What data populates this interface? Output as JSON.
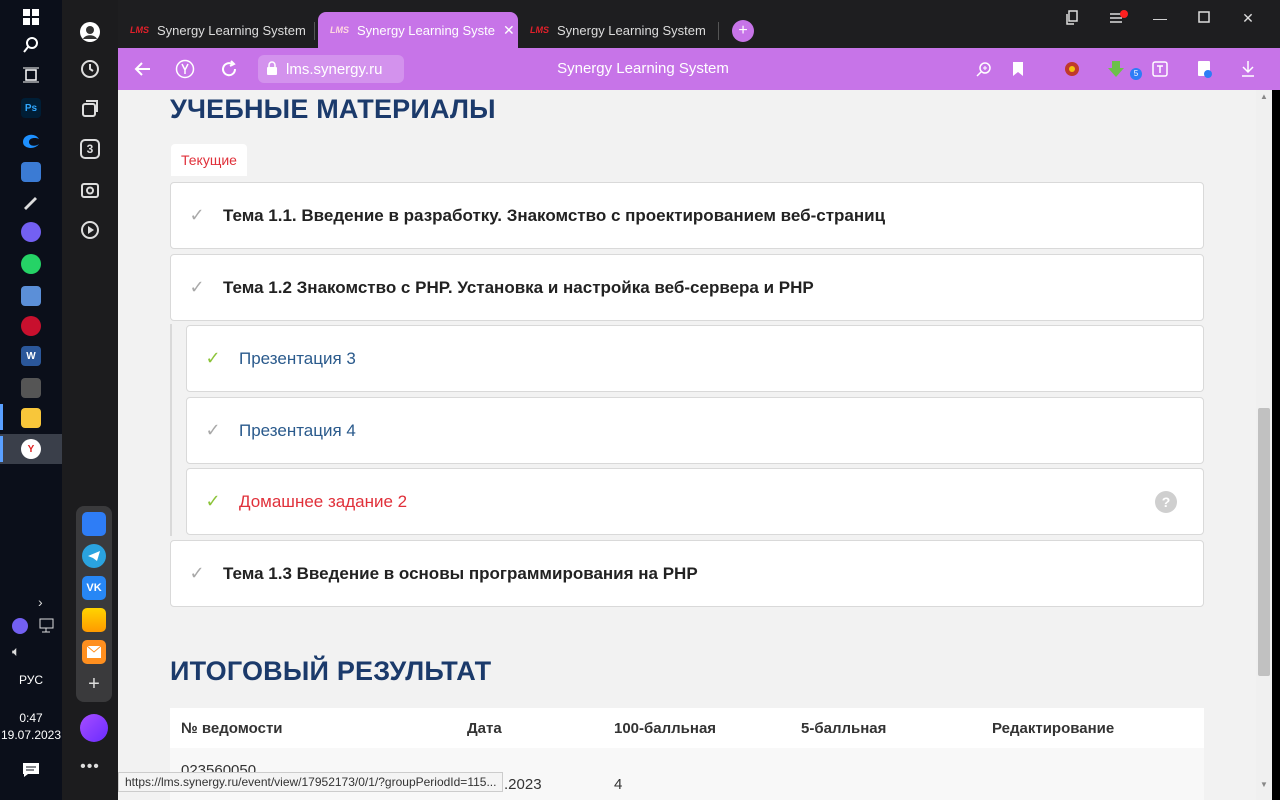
{
  "taskbar": {
    "icons": [
      "windows-start-icon",
      "search-icon",
      "task-view-icon",
      "photoshop-app",
      "edge-app",
      "remote-app",
      "pen-app",
      "viber-app",
      "whatsapp-app",
      "monitor-app",
      "rubles-app",
      "word-app",
      "calculator-app",
      "explorer-app",
      "yandex-browser-app"
    ],
    "photoshop_label": "Ps",
    "word_label": "W",
    "lang": "РУС",
    "time": "0:47",
    "date": "19.07.2023"
  },
  "sidepanel": {
    "tab_count": "3"
  },
  "tabs": [
    {
      "favicon": "LMS",
      "title": "Synergy Learning System",
      "active": false
    },
    {
      "favicon": "LMS",
      "title": "Synergy Learning System",
      "active": true
    },
    {
      "favicon": "LMS",
      "title": "Synergy Learning System",
      "active": false
    }
  ],
  "newtab_label": "+",
  "address": {
    "url": "lms.synergy.ru",
    "page_title": "Synergy Learning System",
    "downloads_count": "5"
  },
  "materials": {
    "heading": "УЧЕБНЫЕ МАТЕРИАЛЫ",
    "tab_label": "Текущие",
    "topics": [
      {
        "label": "Тема 1.1. Введение в разработку. Знакомство с проектированием веб-страниц"
      },
      {
        "label": "Тема 1.2 Знакомство с PHP. Установка и настройка веб-сервера и PHP"
      },
      {
        "label": "Тема 1.3 Введение в основы программирования на PHP"
      }
    ],
    "subitems": [
      {
        "label": "Презентация 3",
        "done": true
      },
      {
        "label": "Презентация 4",
        "done": false
      },
      {
        "label": "Домашнее задание 2",
        "done": true
      }
    ]
  },
  "results": {
    "heading": "ИТОГОВЫЙ РЕЗУЛЬТАТ",
    "columns": [
      "№ ведомости",
      "Дата",
      "100-балльная",
      "5-балльная",
      "Редактирование"
    ],
    "row": {
      "number": "023560050",
      "date": ".2023",
      "score100": "4"
    }
  },
  "status_url": "https://lms.synergy.ru/event/view/17952173/0/1/?groupPeriodId=115...",
  "help_symbol": "?"
}
